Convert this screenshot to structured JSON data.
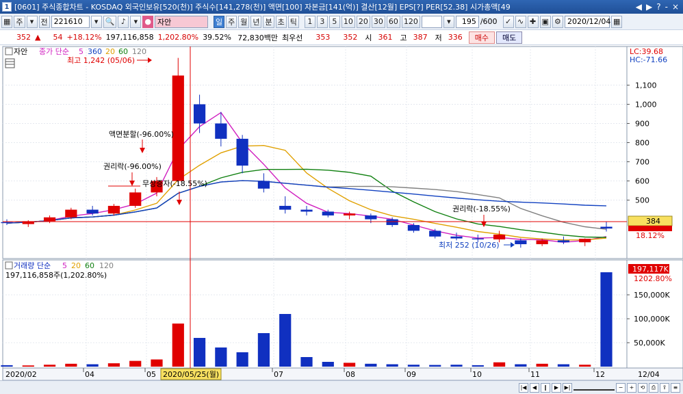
{
  "window": {
    "number": "1",
    "title": "[0601] 주식종합차트 - KOSDAQ 외국인보유[520(천)] 주식수[141,278(천)] 액면[100] 자본금[141(억)] 결산[12월] EPS[?] PER[52.38] 시가총액[49",
    "controls": [
      "◀",
      "▶",
      "?",
      "-",
      "×"
    ]
  },
  "toolbar": {
    "type_btn": "주",
    "market_btn": "전",
    "code": "221610",
    "name": "자안",
    "period_buttons": [
      "일",
      "주",
      "월",
      "년",
      "분",
      "초",
      "틱"
    ],
    "period_selected": "일",
    "interval_buttons": [
      "1",
      "3",
      "5",
      "10",
      "20",
      "30",
      "60",
      "120"
    ],
    "count": "195",
    "count_total": "/600",
    "date": "2020/12/04"
  },
  "quote": {
    "price": "352",
    "change": "54",
    "change_rate": "+18.12%",
    "volume": "197,116,858",
    "volume_rate": "1,202.80%",
    "turnover": "39.52%",
    "amount": "72,830백만",
    "pref_label": "최우선",
    "pref_ask": "353",
    "pref_bid": "352",
    "open_label": "시",
    "open": "361",
    "high_label": "고",
    "high": "387",
    "low_label": "저",
    "low": "336",
    "buy_label": "매수",
    "sell_label": "매도"
  },
  "colors": {
    "up": "#e00000",
    "down": "#1030c0",
    "ma5": "#d020c0",
    "ma20": "#e0a000",
    "ma60": "#108010",
    "ma120": "#808080",
    "ma360": "#1040c0"
  },
  "price_legend": {
    "stock": "자안",
    "series": "종가 단순",
    "p1": "5",
    "p2": "360",
    "p3": "20",
    "p4": "60",
    "p5": "120"
  },
  "price_axis": {
    "lc": "LC:39.68",
    "hc": "HC:-71.66",
    "ticks": [
      "1,100",
      "1,000",
      "900",
      "800",
      "700",
      "600",
      "500",
      "384"
    ],
    "current": "384",
    "current_pct": "18.12%"
  },
  "annotations": {
    "high": "최고 1,242 (05/06)",
    "split": "액면분할(-96.00%)",
    "rights1": "권리락(-96.00%)",
    "bonus": "무상증자(-18.55%)",
    "rights2": "권리락(-18.55%)",
    "low": "최저 252 (10/26)"
  },
  "volume_legend": {
    "series": "거래량 단순",
    "p1": "5",
    "p2": "20",
    "p3": "60",
    "p4": "120",
    "value": "197,116,858주(1,202.80%)"
  },
  "volume_axis": {
    "current": "197,117K",
    "current_pct": "1202.80%",
    "ticks": [
      "150,000K",
      "100,000K",
      "50,000K"
    ]
  },
  "x_axis": {
    "labels": [
      "2020/02",
      "04",
      "05",
      "07",
      "08",
      "09",
      "10",
      "11",
      "12",
      "12/04"
    ],
    "crosshair_date": "2020/05/25(월)"
  },
  "chart_data": {
    "type": "candlestick",
    "price_range": [
      220,
      1280
    ],
    "volume_range": [
      0,
      200000
    ],
    "candles": [
      {
        "date": "2020/02",
        "o": 385,
        "h": 400,
        "l": 370,
        "c": 380,
        "v": 3000
      },
      {
        "date": "2020/02",
        "o": 375,
        "h": 395,
        "l": 360,
        "c": 390,
        "v": 2500
      },
      {
        "date": "2020/03",
        "o": 390,
        "h": 420,
        "l": 380,
        "c": 410,
        "v": 4000
      },
      {
        "date": "2020/03",
        "o": 410,
        "h": 460,
        "l": 400,
        "c": 450,
        "v": 6000
      },
      {
        "date": "2020/03",
        "o": 450,
        "h": 470,
        "l": 420,
        "c": 430,
        "v": 5000
      },
      {
        "date": "2020/04",
        "o": 430,
        "h": 480,
        "l": 420,
        "c": 470,
        "v": 7000
      },
      {
        "date": "2020/04",
        "o": 470,
        "h": 560,
        "l": 460,
        "c": 540,
        "v": 12000
      },
      {
        "date": "2020/04",
        "o": 540,
        "h": 620,
        "l": 520,
        "c": 600,
        "v": 15000
      },
      {
        "date": "2020/05",
        "o": 600,
        "h": 1242,
        "l": 590,
        "c": 1150,
        "v": 90000
      },
      {
        "date": "2020/05",
        "o": 1000,
        "h": 1050,
        "l": 850,
        "c": 900,
        "v": 60000
      },
      {
        "date": "2020/05",
        "o": 900,
        "h": 960,
        "l": 780,
        "c": 820,
        "v": 40000
      },
      {
        "date": "2020/05",
        "o": 820,
        "h": 840,
        "l": 640,
        "c": 680,
        "v": 30000
      },
      {
        "date": "2020/05",
        "o": 600,
        "h": 640,
        "l": 540,
        "c": 560,
        "v": 70000
      },
      {
        "date": "2020/05/25",
        "o": 470,
        "h": 520,
        "l": 430,
        "c": 450,
        "v": 110000
      },
      {
        "date": "2020/06",
        "o": 450,
        "h": 470,
        "l": 420,
        "c": 440,
        "v": 20000
      },
      {
        "date": "2020/06",
        "o": 440,
        "h": 450,
        "l": 410,
        "c": 420,
        "v": 10000
      },
      {
        "date": "2020/06",
        "o": 420,
        "h": 440,
        "l": 400,
        "c": 430,
        "v": 8000
      },
      {
        "date": "2020/07",
        "o": 420,
        "h": 430,
        "l": 380,
        "c": 400,
        "v": 6000
      },
      {
        "date": "2020/07",
        "o": 400,
        "h": 410,
        "l": 360,
        "c": 370,
        "v": 5000
      },
      {
        "date": "2020/08",
        "o": 370,
        "h": 380,
        "l": 330,
        "c": 340,
        "v": 4000
      },
      {
        "date": "2020/08",
        "o": 340,
        "h": 350,
        "l": 300,
        "c": 310,
        "v": 3500
      },
      {
        "date": "2020/09",
        "o": 310,
        "h": 330,
        "l": 290,
        "c": 300,
        "v": 4000
      },
      {
        "date": "2020/09",
        "o": 300,
        "h": 320,
        "l": 280,
        "c": 295,
        "v": 3000
      },
      {
        "date": "2020/10",
        "o": 295,
        "h": 340,
        "l": 280,
        "c": 320,
        "v": 9000
      },
      {
        "date": "2020/10/26",
        "o": 290,
        "h": 300,
        "l": 252,
        "c": 270,
        "v": 5000
      },
      {
        "date": "2020/11",
        "o": 270,
        "h": 300,
        "l": 260,
        "c": 290,
        "v": 6000
      },
      {
        "date": "2020/11",
        "o": 290,
        "h": 310,
        "l": 270,
        "c": 280,
        "v": 5000
      },
      {
        "date": "2020/12",
        "o": 280,
        "h": 300,
        "l": 260,
        "c": 298,
        "v": 4000
      },
      {
        "date": "2020/12/04",
        "o": 361,
        "h": 387,
        "l": 336,
        "c": 352,
        "v": 197117
      }
    ]
  }
}
